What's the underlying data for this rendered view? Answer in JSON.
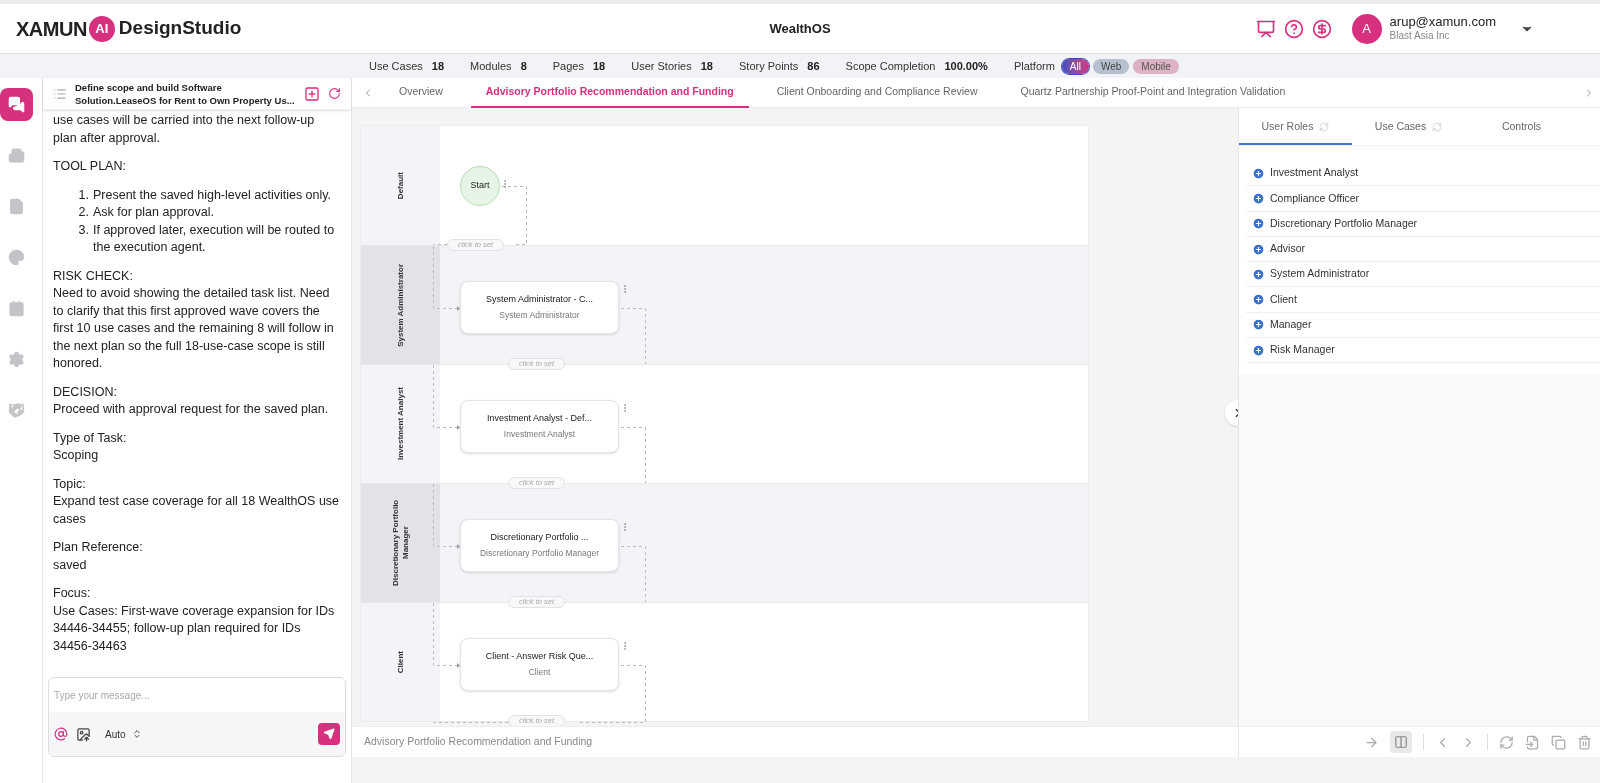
{
  "header": {
    "logo": {
      "word": "XAMUN",
      "badge": "AI",
      "product": "DesignStudio"
    },
    "project": "WealthOS",
    "user": {
      "avatar": "A",
      "email": "arup@xamun.com",
      "company": "Blast Asia Inc"
    }
  },
  "stats": [
    {
      "label": "Use Cases",
      "value": "18"
    },
    {
      "label": "Modules",
      "value": "8"
    },
    {
      "label": "Pages",
      "value": "18"
    },
    {
      "label": "User Stories",
      "value": "18"
    },
    {
      "label": "Story Points",
      "value": "86"
    },
    {
      "label": "Scope Completion",
      "value": "100.00%"
    }
  ],
  "platform": {
    "label": "Platform",
    "options": [
      {
        "label": "All",
        "selected": true
      },
      {
        "label": "Web",
        "selected": false
      },
      {
        "label": "Mobile",
        "selected": false
      }
    ]
  },
  "nav": [
    {
      "kind": "chat",
      "selected": true
    },
    {
      "kind": "building",
      "selected": false
    },
    {
      "kind": "document",
      "selected": false
    },
    {
      "kind": "palette",
      "selected": false
    },
    {
      "kind": "calendar",
      "selected": false
    },
    {
      "kind": "settings",
      "selected": false
    },
    {
      "kind": "handshake",
      "selected": false
    }
  ],
  "chat": {
    "title": "Define scope and build Software Solution.LeaseOS for Rent to Own Property Us...",
    "blocks": [
      {
        "kind": "para",
        "lines": [
          "use cases will be carried into the next follow-up plan after approval."
        ]
      },
      {
        "kind": "para",
        "lines": [
          "TOOL PLAN:"
        ]
      },
      {
        "kind": "list",
        "items": [
          {
            "number": "1.",
            "text": "Present the saved high-level activities only."
          },
          {
            "number": "2.",
            "text": "Ask for plan approval."
          },
          {
            "number": "3.",
            "text": "If approved later, execution will be routed to the execution agent."
          }
        ]
      },
      {
        "kind": "para",
        "lines": [
          "RISK CHECK:",
          "Need to avoid showing the detailed task list. Need to clarify that this first approved wave covers the first 10 use cases and the remaining 8 will follow in the next plan so the full 18-use-case scope is still honored."
        ]
      },
      {
        "kind": "para",
        "lines": [
          "DECISION:",
          "Proceed with approval request for the saved plan."
        ]
      },
      {
        "kind": "para",
        "lines": [
          "Type of Task:",
          "Scoping"
        ]
      },
      {
        "kind": "para",
        "lines": [
          "Topic:",
          "Expand test case coverage for all 18 WealthOS use cases"
        ]
      },
      {
        "kind": "para",
        "lines": [
          "Plan Reference:",
          "saved"
        ]
      },
      {
        "kind": "para",
        "lines": [
          "Focus:",
          "Use Cases: First-wave coverage expansion for IDs 34446-34455; follow-up plan required for IDs 34456-34463"
        ]
      }
    ],
    "placeholder": "Type your message...",
    "mode": "Auto"
  },
  "tabs": [
    {
      "label": "Overview",
      "selected": false
    },
    {
      "label": "Advisory Portfolio Recommendation and Funding",
      "selected": true
    },
    {
      "label": "Client Onboarding and Compliance Review",
      "selected": false
    },
    {
      "label": "Quartz Partnership Proof-Point and Integration Validation",
      "selected": false
    }
  ],
  "diagram": {
    "lanes": [
      {
        "label": "Default",
        "shaded": false,
        "kind": "start",
        "node": {
          "title": "Start"
        },
        "link": "click to set"
      },
      {
        "label": "System Administrator",
        "shaded": true,
        "kind": "task",
        "node": {
          "title": "System Administrator - C...",
          "subtitle": "System Administrator"
        },
        "link": "click to set"
      },
      {
        "label": "Investment Analyst",
        "shaded": false,
        "kind": "task",
        "node": {
          "title": "Investment Analyst - Def...",
          "subtitle": "Investment Analyst"
        },
        "link": "click to set"
      },
      {
        "label": "Discretionary Portfolio Manager",
        "shaded": true,
        "kind": "task",
        "node": {
          "title": "Discretionary Portfolio ...",
          "subtitle": "Discretionary Portfolio Manager"
        },
        "link": "click to set"
      },
      {
        "label": "Client",
        "shaded": false,
        "kind": "task",
        "node": {
          "title": "Client - Answer Risk Que...",
          "subtitle": "Client"
        },
        "link": "click to set"
      }
    ]
  },
  "footer": {
    "title": "Advisory Portfolio Recommendation and Funding"
  },
  "panel": {
    "tabs": [
      {
        "label": "User Roles",
        "selected": true,
        "refresh": true
      },
      {
        "label": "Use Cases",
        "selected": false,
        "refresh": true
      },
      {
        "label": "Controls",
        "selected": false,
        "refresh": false
      }
    ],
    "roles": [
      "Investment Analyst",
      "Compliance Officer",
      "Discretionary Portfolio Manager",
      "Advisor",
      "System Administrator",
      "Client",
      "Manager",
      "Risk Manager"
    ]
  }
}
